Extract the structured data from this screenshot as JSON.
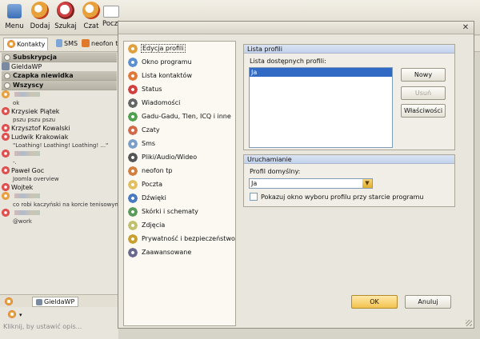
{
  "toolbar": {
    "buttons": [
      {
        "label": "Menu",
        "icon": "menu-icon"
      },
      {
        "label": "Dodaj",
        "icon": "add-contact-icon"
      },
      {
        "label": "Szukaj",
        "icon": "search-icon"
      },
      {
        "label": "Czat",
        "icon": "chat-icon"
      },
      {
        "label": "Poczt",
        "icon": "mail-icon"
      }
    ]
  },
  "tabs": {
    "contacts": "Kontakty",
    "sms": "SMS",
    "neofon": "neofon t"
  },
  "contacts": {
    "groups": {
      "subscription": "Subskrypcja",
      "invisible": "Czapka niewidka",
      "all": "Wszyscy"
    },
    "gieldawp": "GieldaWP",
    "items": [
      {
        "name": "",
        "status_text": "ok",
        "icon_color": "#e8a040"
      },
      {
        "name": "Krzysiek Piątek",
        "status_text": "pszu pszu pszu",
        "icon_color": "#e05050"
      },
      {
        "name": "Krzysztof Kowalski",
        "status_text": "",
        "icon_color": "#e05050"
      },
      {
        "name": "Ludwik Krakowiak",
        "status_text": "\"Loathing! Loathing! Loathing! ...\"",
        "icon_color": "#e05050"
      },
      {
        "name": "",
        "status_text": "-.",
        "icon_color": "#e05050"
      },
      {
        "name": "Paweł Goc",
        "status_text": "Joomla overview",
        "icon_color": "#e05050"
      },
      {
        "name": "Wojtek",
        "status_text": "",
        "icon_color": "#e05050"
      },
      {
        "name": "",
        "status_text": "co robi kaczyński na korcie tenisowym?",
        "icon_color": "#e8a040"
      },
      {
        "name": "",
        "status_text": "@work",
        "icon_color": "#e05050"
      }
    ]
  },
  "bottom_tabs": {
    "gieldawp": "GieldaWP"
  },
  "status_placeholder": "Kliknij, by ustawić opis...",
  "dialog": {
    "categories": [
      {
        "label": "Edycja profili",
        "icon": "profile-edit-icon",
        "selected": true
      },
      {
        "label": "Okno programu",
        "icon": "window-icon"
      },
      {
        "label": "Lista kontaktów",
        "icon": "contact-list-icon"
      },
      {
        "label": "Status",
        "icon": "status-icon"
      },
      {
        "label": "Wiadomości",
        "icon": "messages-icon"
      },
      {
        "label": "Gadu-Gadu, Tlen, ICQ i inne",
        "icon": "protocols-icon"
      },
      {
        "label": "Czaty",
        "icon": "chats-icon"
      },
      {
        "label": "Sms",
        "icon": "sms-icon"
      },
      {
        "label": "Pliki/Audio/Wideo",
        "icon": "media-icon"
      },
      {
        "label": "neofon tp",
        "icon": "phone-icon"
      },
      {
        "label": "Poczta",
        "icon": "mail-icon"
      },
      {
        "label": "Dźwięki",
        "icon": "sound-icon"
      },
      {
        "label": "Skórki i schematy",
        "icon": "skins-icon"
      },
      {
        "label": "Zdjęcia",
        "icon": "photos-icon"
      },
      {
        "label": "Prywatność i bezpieczeństwo",
        "icon": "lock-icon"
      },
      {
        "label": "Zaawansowane",
        "icon": "advanced-icon"
      }
    ],
    "profiles_section": {
      "title": "Lista profili",
      "available_label": "Lista dostępnych profili:",
      "profiles": [
        "Ja"
      ],
      "buttons": {
        "new": "Nowy",
        "delete": "Usuń",
        "properties": "Właściwości"
      }
    },
    "startup_section": {
      "title": "Uruchamianie",
      "default_label": "Profil domyślny:",
      "default_value": "Ja",
      "checkbox_label": "Pokazuj okno wyboru profilu przy starcie programu",
      "checkbox_checked": false
    },
    "ok": "OK",
    "cancel": "Anuluj"
  }
}
